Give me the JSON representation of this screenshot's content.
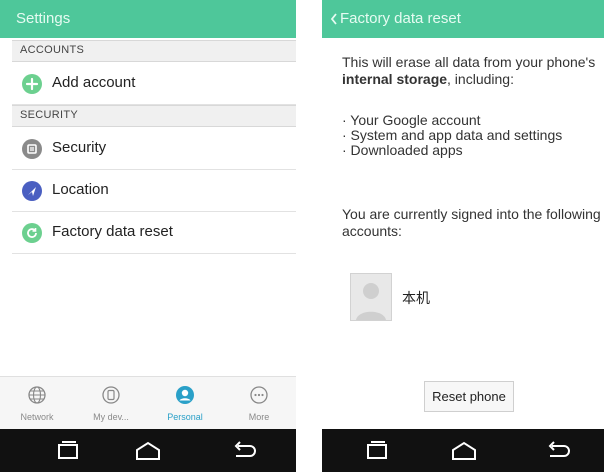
{
  "settings": {
    "title": "Settings",
    "sections": [
      {
        "header": "ACCOUNTS",
        "items": [
          {
            "label": "Add account",
            "icon": "add-icon",
            "color": "#6cd08f"
          }
        ]
      },
      {
        "header": "SECURITY",
        "items": [
          {
            "label": "Security",
            "icon": "security-icon",
            "color": "#8a8a8a"
          },
          {
            "label": "Location",
            "icon": "location-icon",
            "color": "#4a5fc1"
          },
          {
            "label": "Factory data reset",
            "icon": "reset-icon",
            "color": "#6cd08f"
          }
        ]
      }
    ],
    "tabs": [
      {
        "label": "Network",
        "icon": "globe-icon",
        "active": false
      },
      {
        "label": "My dev...",
        "icon": "device-icon",
        "active": false
      },
      {
        "label": "Personal",
        "icon": "person-icon",
        "active": true
      },
      {
        "label": "More",
        "icon": "more-icon",
        "active": false
      }
    ]
  },
  "factory_reset": {
    "title": "Factory data reset",
    "intro_before": "This will erase all data from your phone's ",
    "intro_bold": "internal storage",
    "intro_after": ", including:",
    "bullets": [
      "· Your Google account",
      "· System and app data and settings",
      "· Downloaded apps"
    ],
    "signed_in_text": "You are currently signed into the following accounts:",
    "account_name": "本机",
    "reset_button": "Reset phone"
  },
  "colors": {
    "accent": "#4ec79a",
    "active_tab": "#2aa0c8",
    "navbar": "#111111"
  }
}
